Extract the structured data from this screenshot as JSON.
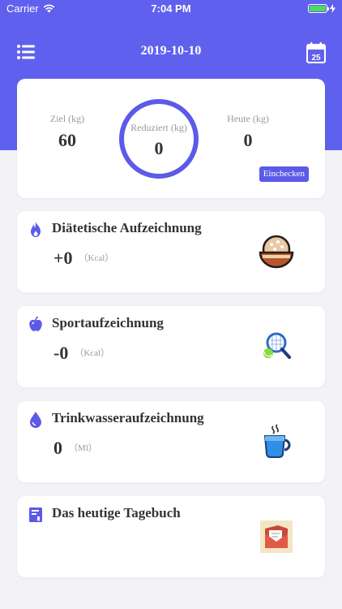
{
  "status_bar": {
    "carrier": "Carrier",
    "time": "7:04 PM"
  },
  "header": {
    "date": "2019-10-10",
    "accent_color": "#6060ee"
  },
  "summary": {
    "goal_label": "Ziel (kg)",
    "goal_value": "60",
    "reduced_label": "Reduziert (kg)",
    "reduced_value": "0",
    "today_label": "Heute (kg)",
    "today_value": "0",
    "checkin_label": "Einchecken"
  },
  "records": {
    "diet": {
      "title": "Diätetische Aufzeichnung",
      "value": "+0",
      "unit": "（Kcal）"
    },
    "sport": {
      "title": "Sportaufzeichnung",
      "value": "-0",
      "unit": "（Kcal）"
    },
    "water": {
      "title": "Trinkwasseraufzeichnung",
      "value": "0",
      "unit": "（Ml）"
    },
    "diary": {
      "title": "Das heutige Tagebuch"
    }
  }
}
